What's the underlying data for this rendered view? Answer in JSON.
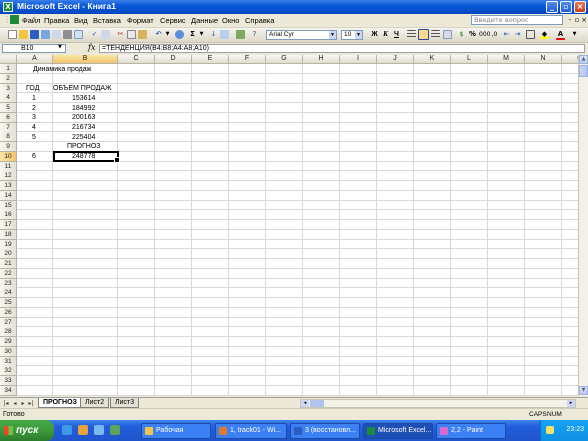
{
  "window": {
    "title": "Microsoft Excel - Книга1"
  },
  "menu": {
    "items": [
      "Файл",
      "Правка",
      "Вид",
      "Вставка",
      "Формат",
      "Сервис",
      "Данные",
      "Окно",
      "Справка"
    ],
    "help_placeholder": "Введите вопрос"
  },
  "toolbar": {
    "font": "Arial Cyr",
    "size": "10",
    "bold": "Ж",
    "italic": "К",
    "underline": "Ч",
    "percent": "%",
    "sum": "Σ"
  },
  "formula_bar": {
    "name_box": "B10",
    "fx": "fx",
    "formula": "=ТЕНДЕНЦИЯ(B4:B8;A4:A8;A10)"
  },
  "grid": {
    "columns": [
      "A",
      "B",
      "C",
      "D",
      "E",
      "F",
      "G",
      "H",
      "I",
      "J",
      "K",
      "L",
      "M",
      "N",
      "O"
    ],
    "rows": [
      "1",
      "2",
      "3",
      "4",
      "5",
      "6",
      "7",
      "8",
      "9",
      "10",
      "11",
      "12",
      "13",
      "14",
      "15",
      "16",
      "17",
      "18",
      "19",
      "20",
      "21",
      "22",
      "23",
      "24",
      "25",
      "26",
      "27",
      "28",
      "29",
      "30",
      "31",
      "32",
      "33",
      "34"
    ],
    "selected_cell": "B10",
    "cells": {
      "A1": "Динамика продаж",
      "A3": "ГОД",
      "B3": "ОБЪЕМ ПРОДАЖ",
      "A4": "1",
      "B4": "153614",
      "A5": "2",
      "B5": "184992",
      "A6": "3",
      "B6": "200163",
      "A7": "4",
      "B7": "216734",
      "A8": "5",
      "B8": "225404",
      "B9": "ПРОГНОЗ",
      "A10": "6",
      "B10": "248778"
    }
  },
  "sheets": {
    "tabs": [
      "ПРОГНОЗ",
      "Лист2",
      "Лист3"
    ],
    "active": "ПРОГНОЗ"
  },
  "status": {
    "text": "Готово",
    "caps": "CAPS",
    "num": "NUM"
  },
  "taskbar": {
    "start": "пуск",
    "tasks": [
      "Рабочая",
      "1, track01 - Wi...",
      "3 (восстановл...",
      "Microsoft Excel...",
      "2,2 - Paint"
    ],
    "clock": "23:23"
  }
}
